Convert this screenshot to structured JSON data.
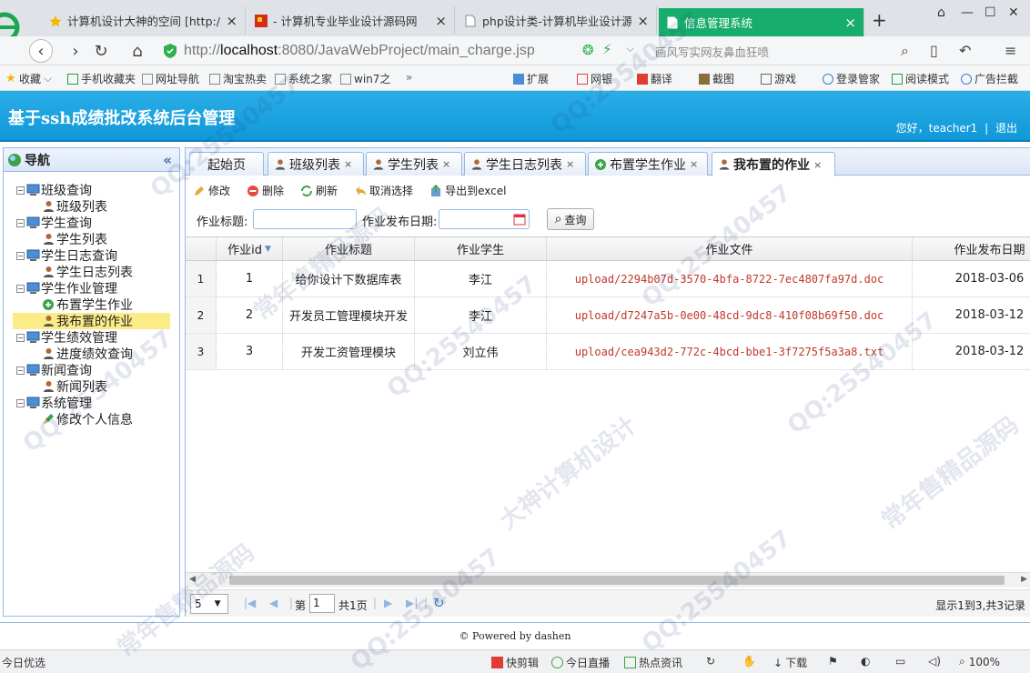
{
  "browser": {
    "tabs": [
      {
        "label": "计算机设计大神的空间 [http://",
        "icon": "star-icon"
      },
      {
        "label": "- 计算机专业毕业设计源码网",
        "icon": "site-icon"
      },
      {
        "label": "php设计类-计算机毕业设计源",
        "icon": "page-icon"
      },
      {
        "label": "信息管理系统",
        "icon": "page-icon"
      }
    ],
    "new_tab": "+",
    "url_prefix": "http://",
    "url_host": "localhost",
    "url_path": ":8080/JavaWebProject/main_charge.jsp",
    "search_hint": "画风写实网友鼻血狂喷",
    "bookmarks": [
      "收藏",
      "手机收藏夹",
      "网址导航",
      "淘宝热卖",
      "系统之家",
      "win7之"
    ],
    "bookmark_more": "»",
    "toolbar_right": [
      "扩展",
      "网银",
      "翻译",
      "截图",
      "游戏",
      "登录管家",
      "阅读模式",
      "广告拦截"
    ]
  },
  "header": {
    "title": "基于ssh成绩批改系统后台管理",
    "greeting": "您好，teacher1",
    "separator": "|",
    "logout": "退出"
  },
  "sidebar": {
    "title": "导航",
    "collapse": "«",
    "tree": [
      {
        "label": "班级查询",
        "children": [
          {
            "label": "班级列表"
          }
        ]
      },
      {
        "label": "学生查询",
        "children": [
          {
            "label": "学生列表"
          }
        ]
      },
      {
        "label": "学生日志查询",
        "children": [
          {
            "label": "学生日志列表"
          }
        ]
      },
      {
        "label": "学生作业管理",
        "children": [
          {
            "label": "布置学生作业"
          },
          {
            "label": "我布置的作业",
            "selected": true
          }
        ]
      },
      {
        "label": "学生绩效管理",
        "children": [
          {
            "label": "进度绩效查询"
          }
        ]
      },
      {
        "label": "新闻查询",
        "children": [
          {
            "label": "新闻列表"
          }
        ]
      },
      {
        "label": "系统管理",
        "children": [
          {
            "label": "修改个人信息"
          }
        ]
      }
    ]
  },
  "content_tabs": [
    {
      "label": "起始页",
      "closable": false
    },
    {
      "label": "班级列表",
      "closable": true
    },
    {
      "label": "学生列表",
      "closable": true
    },
    {
      "label": "学生日志列表",
      "closable": true
    },
    {
      "label": "布置学生作业",
      "closable": true
    },
    {
      "label": "我布置的作业",
      "closable": true,
      "active": true
    }
  ],
  "close_glyph": "×",
  "toolbar": {
    "edit": "修改",
    "delete": "删除",
    "refresh": "刷新",
    "cancel_select": "取消选择",
    "export": "导出到excel"
  },
  "search": {
    "title_label": "作业标题:",
    "title_value": "",
    "date_label": "作业发布日期:",
    "date_value": "",
    "query_label": "查询"
  },
  "grid": {
    "columns": [
      "作业id",
      "作业标题",
      "作业学生",
      "作业文件",
      "作业发布日期"
    ],
    "rows": [
      {
        "num": "1",
        "id": "1",
        "title": "给你设计下数据库表",
        "student": "李江",
        "file": "upload/2294b07d-3570-4bfa-8722-7ec4807fa97d.doc",
        "date": "2018-03-06"
      },
      {
        "num": "2",
        "id": "2",
        "title": "开发员工管理模块开发",
        "student": "李江",
        "file": "upload/d7247a5b-0e00-48cd-9dc8-410f08b69f50.doc",
        "date": "2018-03-12"
      },
      {
        "num": "3",
        "id": "3",
        "title": "开发工资管理模块",
        "student": "刘立伟",
        "file": "upload/cea943d2-772c-4bcd-bbe1-3f7275f5a3a8.txt",
        "date": "2018-03-12"
      }
    ]
  },
  "pager": {
    "page_size": "5",
    "page_prefix": "第",
    "page_value": "1",
    "page_suffix": "共1页",
    "summary": "显示1到3,共3记录"
  },
  "footer": {
    "powered": "Powered by dashen",
    "mark": "©"
  },
  "statusbar": {
    "left": "今日优选",
    "items": [
      "快剪辑",
      "今日直播",
      "热点资讯",
      "下载"
    ],
    "zoom": "100%"
  },
  "watermark": {
    "texts": [
      "QQ:25540457",
      "常年售精品源码",
      "大神计算机设计"
    ]
  },
  "colors": {
    "header_blue": "#1ea3e0",
    "active_browser_tab": "#17ad6c",
    "file_link_red": "#c0392b",
    "selected_node": "#fbec88"
  }
}
